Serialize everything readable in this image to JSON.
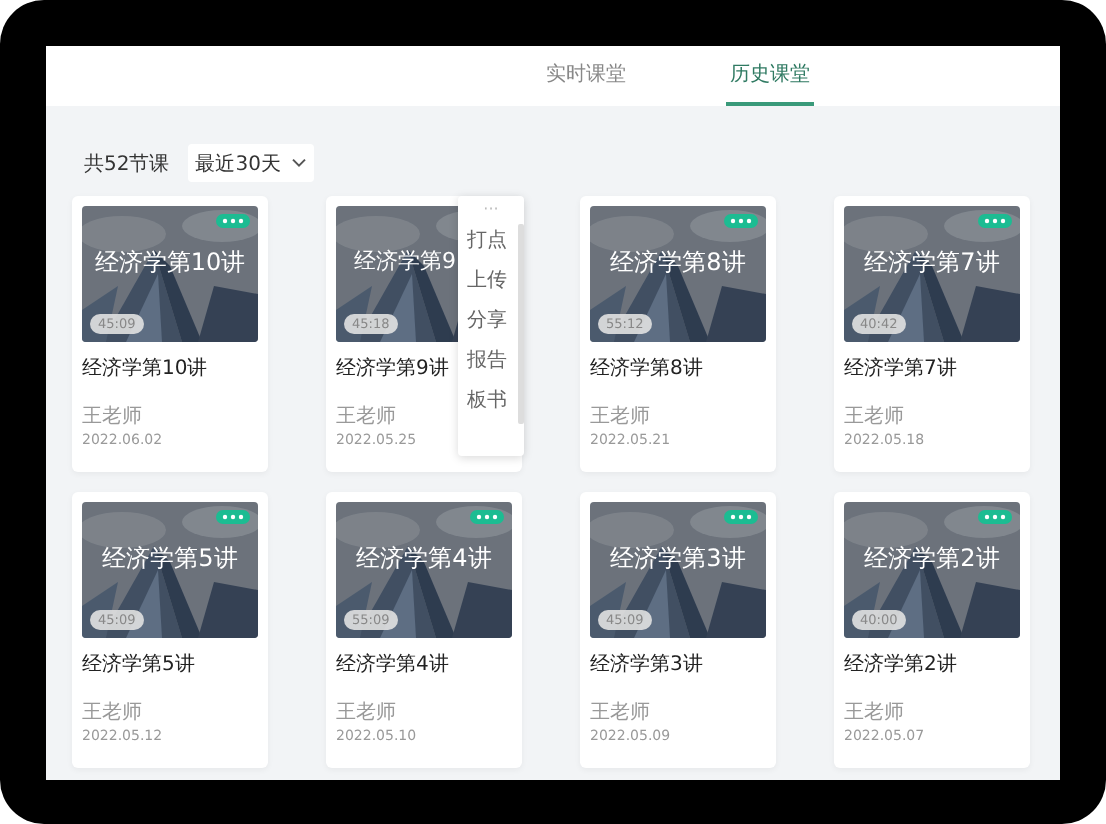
{
  "tabs": [
    {
      "label": "实时课堂",
      "selected": false
    },
    {
      "label": "历史课堂",
      "selected": true
    }
  ],
  "toolbar": {
    "count": "共52节课",
    "range": "最近30天"
  },
  "courses": [
    {
      "cover_title": "经济学第10讲",
      "duration": "45:09",
      "title": "经济学第10讲",
      "teacher": "王老师",
      "date": "2022.06.02"
    },
    {
      "cover_title": "经济学第9",
      "duration": "45:18",
      "title": "经济学第9讲",
      "teacher": "王老师",
      "date": "2022.05.25",
      "menu": {
        "handle": "···",
        "items": [
          "打点",
          "上传",
          "分享",
          "报告",
          "板书"
        ]
      }
    },
    {
      "cover_title": "经济学第8讲",
      "duration": "55:12",
      "title": "经济学第8讲",
      "teacher": "王老师",
      "date": "2022.05.21"
    },
    {
      "cover_title": "经济学第7讲",
      "duration": "40:42",
      "title": "经济学第7讲",
      "teacher": "王老师",
      "date": "2022.05.18"
    },
    {
      "cover_title": "经济学第5讲",
      "duration": "45:09",
      "title": "经济学第5讲",
      "teacher": "王老师",
      "date": "2022.05.12"
    },
    {
      "cover_title": "经济学第4讲",
      "duration": "55:09",
      "title": "经济学第4讲",
      "teacher": "王老师",
      "date": "2022.05.10"
    },
    {
      "cover_title": "经济学第3讲",
      "duration": "45:09",
      "title": "经济学第3讲",
      "teacher": "王老师",
      "date": "2022.05.09"
    },
    {
      "cover_title": "经济学第2讲",
      "duration": "40:00",
      "title": "经济学第2讲",
      "teacher": "王老师",
      "date": "2022.05.07"
    }
  ]
}
